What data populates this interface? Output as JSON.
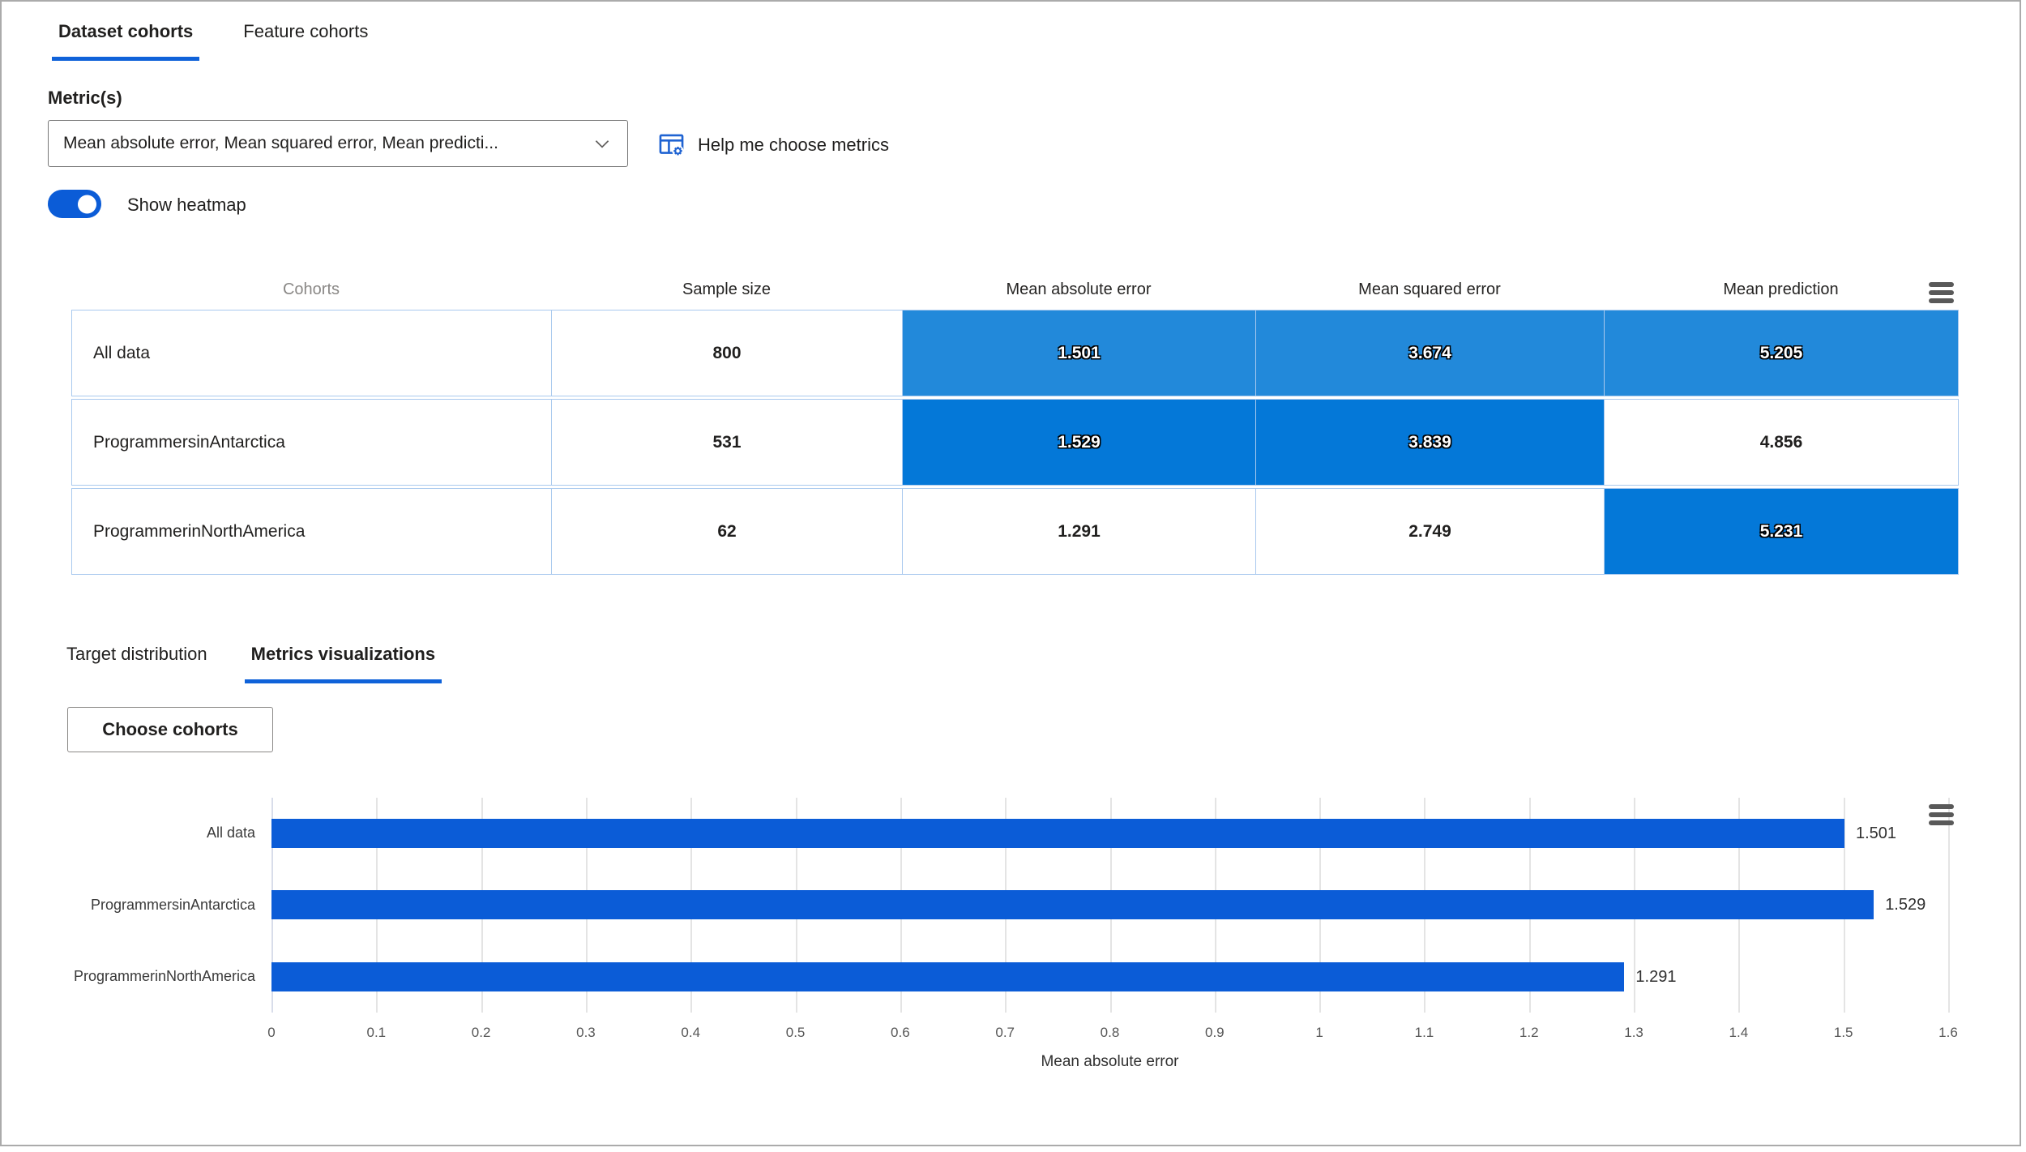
{
  "dataset_tabs": [
    {
      "label": "Dataset cohorts",
      "active": true
    },
    {
      "label": "Feature cohorts",
      "active": false
    }
  ],
  "metrics": {
    "label": "Metric(s)",
    "dropdown_value": "Mean absolute error, Mean squared error, Mean predicti...",
    "help_label": "Help me choose metrics"
  },
  "heatmap_toggle": {
    "label": "Show heatmap",
    "state": "on"
  },
  "icons": {
    "dropdown": "chevron-down",
    "help": "table-settings",
    "table_menu": "hamburger-menu",
    "chart_menu": "hamburger-menu"
  },
  "colors": {
    "accent": "#0F62D9",
    "toggle_on": "#0B5CD7",
    "bar": "#0B5CD7",
    "heat_light": "#2289DA",
    "heat_dark": "#0478D8",
    "cell_border": "#A9C9EE"
  },
  "cohort_table": {
    "columns": [
      "Cohorts",
      "Sample size",
      "Mean absolute error",
      "Mean squared error",
      "Mean prediction"
    ],
    "rows": [
      {
        "cohort": "All data",
        "sample_size": "800",
        "mean_absolute_error": "1.501",
        "mean_squared_error": "3.674",
        "mean_prediction": "5.205",
        "heat": {
          "mae": "#2289DA",
          "mse": "#2289DA",
          "mp": "#2289DA"
        }
      },
      {
        "cohort": "ProgrammersinAntarctica",
        "sample_size": "531",
        "mean_absolute_error": "1.529",
        "mean_squared_error": "3.839",
        "mean_prediction": "4.856",
        "heat": {
          "mae": "#0478D8",
          "mse": "#0478D8",
          "mp": null
        }
      },
      {
        "cohort": "ProgrammerinNorthAmerica",
        "sample_size": "62",
        "mean_absolute_error": "1.291",
        "mean_squared_error": "2.749",
        "mean_prediction": "5.231",
        "heat": {
          "mae": null,
          "mse": null,
          "mp": "#0478D8"
        }
      }
    ]
  },
  "viz_tabs": [
    {
      "label": "Target distribution",
      "active": false
    },
    {
      "label": "Metrics visualizations",
      "active": true
    }
  ],
  "choose_cohorts_button": "Choose cohorts",
  "chart_data": {
    "type": "bar",
    "orientation": "horizontal",
    "categories": [
      "All data",
      "ProgrammersinAntarctica",
      "ProgrammerinNorthAmerica"
    ],
    "values": [
      1.501,
      1.529,
      1.291
    ],
    "value_labels": [
      "1.501",
      "1.529",
      "1.291"
    ],
    "xlabel": "Mean absolute error",
    "xlim": [
      0,
      1.6
    ],
    "xtick_step": 0.1,
    "grid": true,
    "legend": "none",
    "bar_color": "#0B5CD7"
  }
}
